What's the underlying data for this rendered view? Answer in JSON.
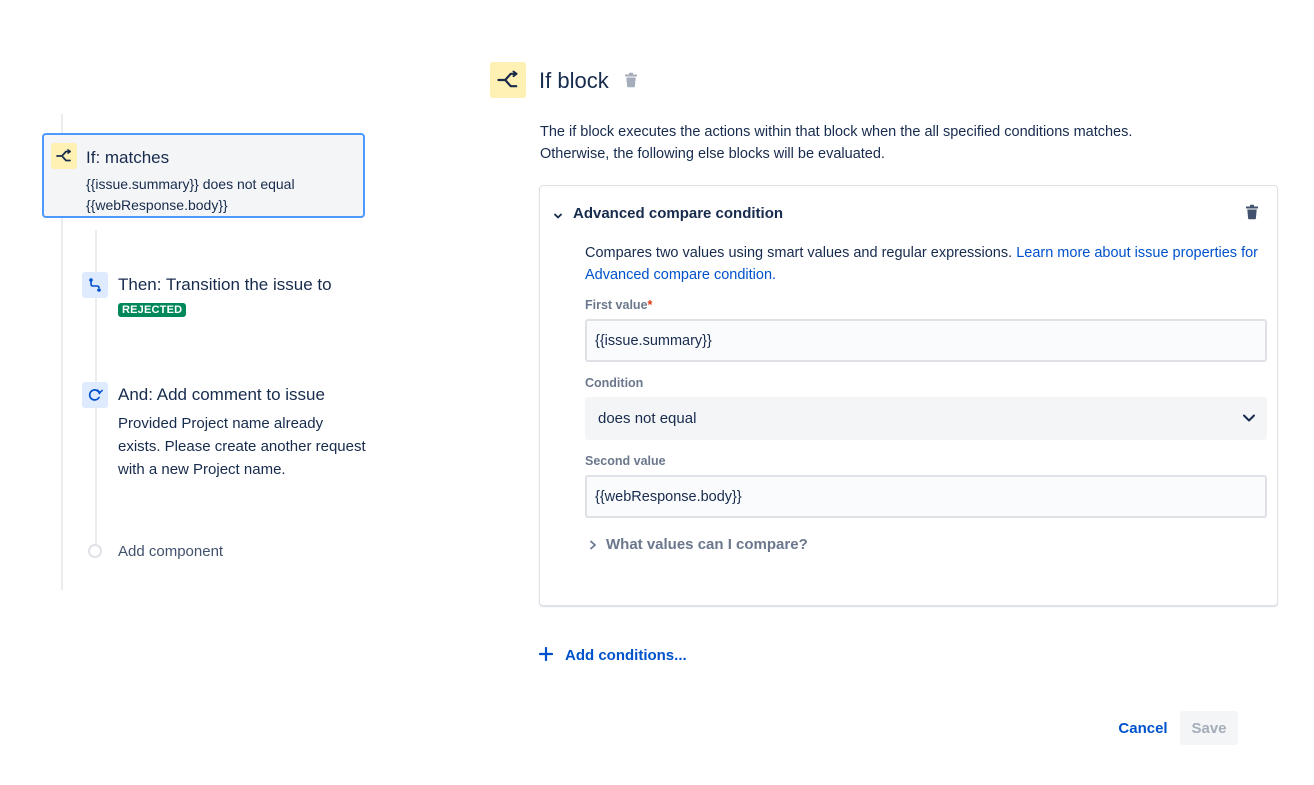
{
  "colors": {
    "brand_link": "#0052cc",
    "selected_border": "#4c9aff",
    "condition_icon_bg": "#fff0b3",
    "action_icon_bg": "#deebff",
    "rejected_lozenge": "#00875a",
    "required_asterisk": "#de350b"
  },
  "rule_tree": {
    "if_node": {
      "icon": "branch-icon",
      "title": "If: matches",
      "description_line1": "{{issue.summary}} does not equal",
      "description_line2": "{{webResponse.body}}"
    },
    "then_node": {
      "icon": "transition-icon",
      "title": "Then: Transition the issue to",
      "status": "REJECTED"
    },
    "and_node": {
      "icon": "comment-icon",
      "title": "And: Add comment to issue",
      "description": "Provided Project name already exists. Please create another request with a new Project name."
    },
    "add_component_label": "Add component"
  },
  "panel": {
    "icon": "branch-icon",
    "title": "If block",
    "delete_icon": "trash-icon",
    "intro_line1": "The if block executes the actions within that block when the all specified conditions matches.",
    "intro_line2": "Otherwise, the following else blocks will be evaluated."
  },
  "condition_card": {
    "title": "Advanced compare condition",
    "description": "Compares two values using smart values and regular expressions.",
    "learn_more_link": "Learn more about issue properties for Advanced compare condition.",
    "first_value_label": "First value",
    "required_marker": "*",
    "first_value": "{{issue.summary}}",
    "condition_label": "Condition",
    "condition_value": "does not equal",
    "second_value_label": "Second value",
    "second_value": "{{webResponse.body}}",
    "what_values_label": "What values can I compare?"
  },
  "footer": {
    "add_conditions_label": "Add conditions...",
    "cancel_label": "Cancel",
    "save_label": "Save"
  }
}
